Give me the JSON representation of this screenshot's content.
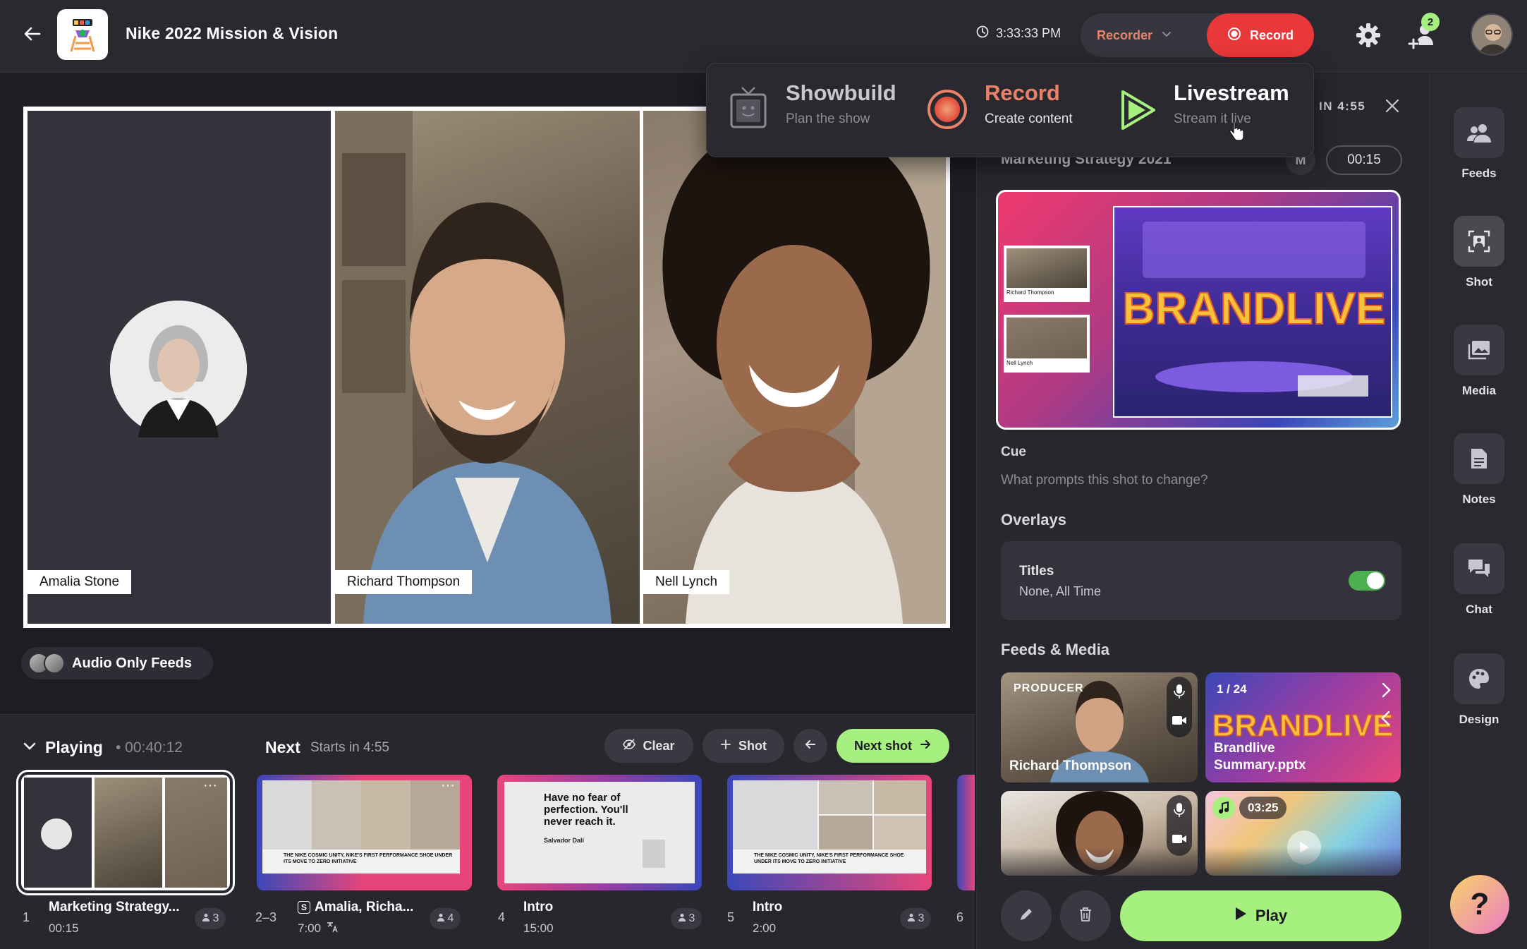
{
  "header": {
    "title": "Nike 2022 Mission & Vision",
    "clock": "3:33:33 PM",
    "recorder_label": "Recorder",
    "record_label": "Record",
    "guest_count": "2"
  },
  "dropdown": {
    "items": [
      {
        "title": "Showbuild",
        "subtitle": "Plan the show"
      },
      {
        "title": "Record",
        "subtitle": "Create content"
      },
      {
        "title": "Livestream",
        "subtitle": "Stream it live"
      }
    ]
  },
  "stage": {
    "tiles": [
      {
        "name": "Amalia Stone"
      },
      {
        "name": "Richard Thompson"
      },
      {
        "name": "Nell Lynch"
      }
    ],
    "audio_only_label": "Audio Only Feeds"
  },
  "rundown": {
    "playing_label": "Playing",
    "playing_time": "• 00:40:12",
    "next_label": "Next",
    "starts_in": "Starts in 4:55",
    "buttons": {
      "clear": "Clear",
      "shot": "Shot",
      "next_shot": "Next shot"
    },
    "cards": [
      {
        "num": "1",
        "title": "Marketing Strategy...",
        "sub": "00:15",
        "count": "3"
      },
      {
        "num": "2–3",
        "title": "Amalia, Richa...",
        "sub": "7:00",
        "count": "4"
      },
      {
        "num": "4",
        "title": "Intro",
        "sub": "15:00",
        "count": "3"
      },
      {
        "num": "5",
        "title": "Intro",
        "sub": "2:00",
        "count": "3"
      },
      {
        "num": "6"
      }
    ],
    "quote": {
      "text": "Have no fear of perfection. You'll never reach it.",
      "author": "Salvador Dalí"
    },
    "slide_caption": "THE NIKE COSMIC UNITY, NIKE'S FIRST PERFORMANCE SHOE UNDER ITS MOVE TO ZERO INITIATIVE"
  },
  "panel": {
    "in_label": "IN 4:55",
    "shot_name": "Marketing Strategy 2021",
    "shot_badge": "M",
    "shot_duration": "00:15",
    "preview_names": [
      "Richard Thompson",
      "Nell Lynch"
    ],
    "cue_label": "Cue",
    "cue_placeholder": "What prompts this shot to change?",
    "overlays_label": "Overlays",
    "titles_label": "Titles",
    "titles_sub": "None, All Time",
    "feeds_media_label": "Feeds & Media",
    "feeds": [
      {
        "badge": "PRODUCER",
        "name": "Richard Thompson"
      },
      {
        "badge": "1 / 24",
        "name": "Brandlive Summary.pptx"
      },
      {},
      {
        "badge": "03:25"
      }
    ],
    "play_label": "Play"
  },
  "rail": [
    {
      "label": "Feeds"
    },
    {
      "label": "Shot"
    },
    {
      "label": "Media"
    },
    {
      "label": "Notes"
    },
    {
      "label": "Chat"
    },
    {
      "label": "Design"
    }
  ],
  "colors": {
    "accent_green": "#a6f07f",
    "record_red": "#e8383a",
    "recorder_orange": "#e8836a",
    "background": "#1e1d23"
  }
}
